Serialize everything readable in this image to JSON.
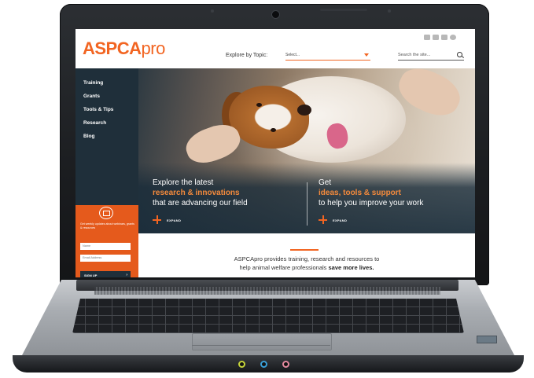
{
  "site": {
    "logo": {
      "part1": "ASPCA",
      "part2": "pro"
    },
    "header": {
      "explore_label": "Explore by Topic:",
      "topic_select_value": "Select...",
      "search_placeholder": "Search the site...",
      "social_icons": [
        "facebook-icon",
        "twitter-icon",
        "youtube-icon",
        "instagram-icon"
      ]
    },
    "sidebar": {
      "items": [
        {
          "label": "Training"
        },
        {
          "label": "Grants"
        },
        {
          "label": "Tools & Tips"
        },
        {
          "label": "Research"
        },
        {
          "label": "Blog"
        }
      ],
      "signup": {
        "text": "Get weekly updates about webinars, grants & resources",
        "name_placeholder": "Name",
        "email_placeholder": "Email Address",
        "button_label": "SIGN UP"
      }
    },
    "hero": {
      "left": {
        "line1": "Explore the latest",
        "highlight": "research & innovations",
        "line3": "that are advancing our field",
        "expand_label": "EXPAND"
      },
      "right": {
        "line1": "Get",
        "highlight": "ideas, tools & support",
        "line3": "to help you improve your work",
        "expand_label": "EXPAND"
      }
    },
    "footer": {
      "line1": "ASPCApro provides training, research and resources to",
      "line2": "help animal welfare professionals",
      "line2_bold": "save more lives."
    }
  },
  "colors": {
    "brand_orange": "#f26522",
    "sidebar_navy": "#1f2f3a",
    "signup_orange": "#e55a1c"
  }
}
